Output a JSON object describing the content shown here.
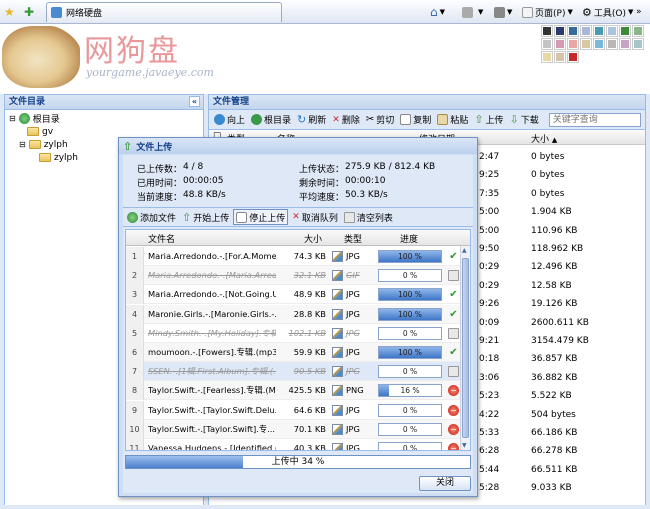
{
  "browser": {
    "tab_title": "网络硬盘",
    "page_menu": "页面(P)",
    "tools_menu": "工具(O)"
  },
  "header": {
    "logo_title": "网狗盘",
    "logo_url": "yourgame.javaeye.com",
    "swatches": [
      "#333333",
      "#2b3b6a",
      "#356a9a",
      "#a8b8d8",
      "#4a9ab0",
      "#aac4e0",
      "#3a8a3a",
      "#8ab48a",
      "#c4c4c4",
      "#d49ab4",
      "#e8a6a6",
      "#d8c8a4",
      "#7ab8d8",
      "#b8b8b8",
      "#c8a4c4",
      "#a8c4c8",
      "#e8d8a4",
      "#d8c4a8",
      "#c42a2a"
    ]
  },
  "left_panel": {
    "title": "文件目录",
    "root": "根目录",
    "folders": [
      "gv",
      "zylph",
      "zylph"
    ]
  },
  "right_panel": {
    "title": "文件管理",
    "toolbar": {
      "up": "向上",
      "root": "根目录",
      "refresh": "刷新",
      "delete": "删除",
      "cut": "剪切",
      "copy": "复制",
      "paste": "粘贴",
      "upload": "上传",
      "download": "下载",
      "search_placeholder": "关键字查询"
    },
    "columns": {
      "type": "类型",
      "name": "名称",
      "date": "修改日期",
      "size": "大小"
    },
    "rows": [
      {
        "date": "2:47",
        "size": "0 bytes"
      },
      {
        "date": "9:25",
        "size": "0 bytes"
      },
      {
        "date": "7:35",
        "size": "0 bytes"
      },
      {
        "date": "5:00",
        "size": "1.904 KB"
      },
      {
        "date": "5:00",
        "size": "110.96 KB"
      },
      {
        "date": "9:50",
        "size": "118.962 KB"
      },
      {
        "date": "0:29",
        "size": "12.496 KB"
      },
      {
        "date": "0:29",
        "size": "12.58 KB"
      },
      {
        "date": "9:26",
        "size": "19.126 KB"
      },
      {
        "date": "0:09",
        "size": "2600.611 KB"
      },
      {
        "date": "9:21",
        "size": "3154.479 KB"
      },
      {
        "date": "0:18",
        "size": "36.857 KB"
      },
      {
        "date": "3:06",
        "size": "36.882 KB"
      },
      {
        "date": "5:23",
        "size": "5.522 KB"
      },
      {
        "date": "4:22",
        "size": "504 bytes"
      },
      {
        "date": "5:33",
        "size": "66.186 KB"
      },
      {
        "date": "6:28",
        "size": "66.278 KB"
      },
      {
        "date": "5:44",
        "size": "66.511 KB"
      },
      {
        "date": "5:28",
        "size": "9.033 KB"
      }
    ]
  },
  "upload_dialog": {
    "title": "文件上传",
    "stats": {
      "uploaded_label": "已上传数：",
      "uploaded_value": "4 / 8",
      "elapsed_label": "已用时间：",
      "elapsed_value": "00:00:05",
      "speed_label": "当前速度：",
      "speed_value": "48.8 KB/s",
      "status_label": "上传状态：",
      "status_value": "275.9 KB / 812.4 KB",
      "remaining_label": "剩余时间：",
      "remaining_value": "00:00:10",
      "avg_label": "平均速度：",
      "avg_value": "50.3 KB/s"
    },
    "toolbar": {
      "add": "添加文件",
      "start": "开始上传",
      "stop": "停止上传",
      "cancel": "取消队列",
      "clear": "清空列表"
    },
    "columns": {
      "name": "文件名",
      "size": "大小",
      "type": "类型",
      "progress": "进度"
    },
    "files": [
      {
        "num": "1",
        "name": "Maria.Arredondo.-.[For.A.Momen...",
        "size": "74.3 KB",
        "type": "JPG",
        "progress": 100,
        "label": "100 %",
        "status": "done",
        "strike": false
      },
      {
        "num": "2",
        "name": "Maria.Arredondo.-.[Maria.Arredo...",
        "size": "32.1 KB",
        "type": "GIF",
        "progress": 0,
        "label": "0 %",
        "status": "removed",
        "strike": true
      },
      {
        "num": "3",
        "name": "Maria.Arredondo.-.[Not.Going.Un...",
        "size": "48.9 KB",
        "type": "JPG",
        "progress": 100,
        "label": "100 %",
        "status": "done",
        "strike": false
      },
      {
        "num": "4",
        "name": "Maronie.Girls.-.[Maronie.Girls.-.1...",
        "size": "28.8 KB",
        "type": "JPG",
        "progress": 100,
        "label": "100 %",
        "status": "done",
        "strike": false
      },
      {
        "num": "5",
        "name": "Mindy.Smith.-.[My.Holiday].专辑...",
        "size": "102.1 KB",
        "type": "JPG",
        "progress": 0,
        "label": "0 %",
        "status": "removed",
        "strike": true
      },
      {
        "num": "6",
        "name": "moumoon.-.[Fowers].专辑.(mp3)...",
        "size": "59.9 KB",
        "type": "JPG",
        "progress": 100,
        "label": "100 %",
        "status": "done",
        "strike": false
      },
      {
        "num": "7",
        "name": "SSEN.-.[1辑.First.Album].专辑.(...",
        "size": "90.5 KB",
        "type": "JPG",
        "progress": 0,
        "label": "0 %",
        "status": "removed",
        "strike": true
      },
      {
        "num": "8",
        "name": "Taylor.Swift.-.[Fearless].专辑.(M...",
        "size": "425.5 KB",
        "type": "PNG",
        "progress": 16,
        "label": "16 %",
        "status": "uploading",
        "strike": false
      },
      {
        "num": "9",
        "name": "Taylor.Swift.-.[Taylor.Swift.Delu...",
        "size": "64.6 KB",
        "type": "JPG",
        "progress": 0,
        "label": "0 %",
        "status": "pending",
        "strike": false
      },
      {
        "num": "10",
        "name": "Taylor.Swift.-.[Taylor.Swift].专...",
        "size": "70.1 KB",
        "type": "JPG",
        "progress": 0,
        "label": "0 %",
        "status": "pending",
        "strike": false
      },
      {
        "num": "11",
        "name": "Vanessa.Hudgens.-.[Identified.(J...",
        "size": "40.3 KB",
        "type": "JPG",
        "progress": 0,
        "label": "0 %",
        "status": "pending",
        "strike": false
      }
    ],
    "overall": {
      "label": "上传中  34 %",
      "progress": 34
    },
    "close_label": "关闭"
  }
}
